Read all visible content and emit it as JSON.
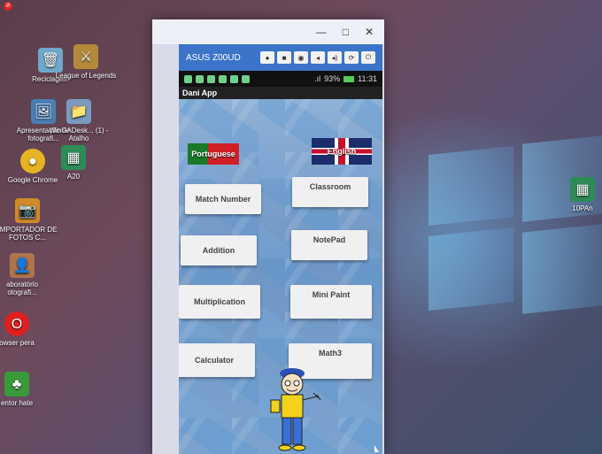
{
  "desktop": {
    "icons": [
      {
        "label": "Reciclagem",
        "glyph": "🗑",
        "color": "#6fa8c8"
      },
      {
        "label": "League of Legends",
        "glyph": "⚔",
        "color": "#b48a3a"
      },
      {
        "label": "Apresentação de fotografi...",
        "glyph": "🖼",
        "color": "#4a7fb5"
      },
      {
        "label": "WinGADesk... (1) - Atalho",
        "glyph": "📁",
        "color": "#7a9ac0"
      },
      {
        "label": "Google Chrome",
        "glyph": "●",
        "color": "#e6b422"
      },
      {
        "label": "A20",
        "glyph": "▦",
        "color": "#2e8b57"
      },
      {
        "label": "IMPORTADOR DE FOTOS C...",
        "glyph": "📷",
        "color": "#d08a2a"
      },
      {
        "label": "aboratório otografi...",
        "glyph": "👤",
        "color": "#b0744a"
      },
      {
        "label": "owser pera",
        "glyph": "O",
        "color": "#e02020"
      },
      {
        "label": "entor hate",
        "glyph": "♣",
        "color": "#3a9a3a"
      },
      {
        "label": "10PAn",
        "glyph": "▦",
        "color": "#2e8b57"
      }
    ]
  },
  "emulator": {
    "window_controls": {
      "minimize": "—",
      "maximize": "□",
      "close": "✕"
    },
    "device_name": "ASUS Z00UD",
    "toolbar_icons": [
      "●",
      "■",
      "◉",
      "◂",
      "◂)",
      "⟳",
      "⏻"
    ],
    "status": {
      "signal": ".ıl",
      "battery": "93%",
      "time": "11:31"
    },
    "app_title": "Dani App",
    "languages": {
      "portuguese": "Portuguese",
      "english": "English"
    },
    "buttons": {
      "match_number": "Match Number",
      "classroom": "Classroom",
      "addition": "Addition",
      "notepad": "NotePad",
      "multiplication": "Multiplication",
      "mini_paint": "Mini Paint",
      "calculator": "Calculator",
      "math3": "Math3"
    }
  }
}
